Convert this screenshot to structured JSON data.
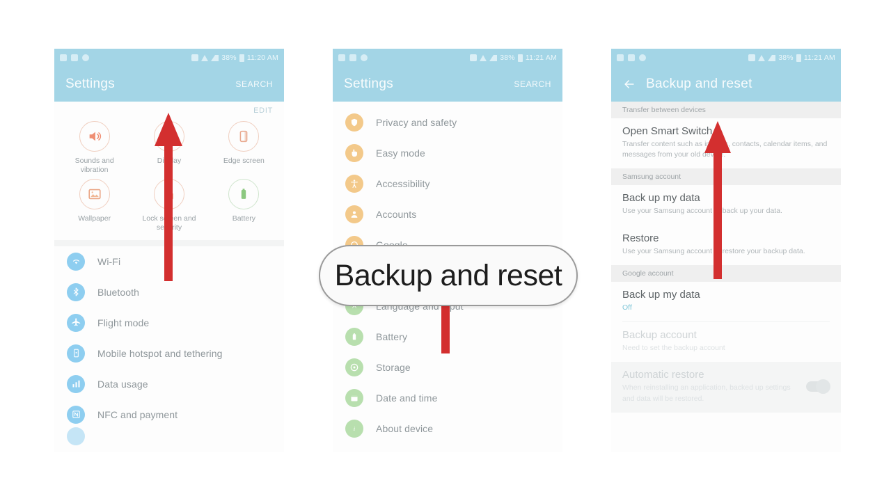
{
  "callout": {
    "text": "Backup and reset"
  },
  "colors": {
    "header_blue": "#a3d5e6",
    "arrow_red": "#d32f2f",
    "icon_blue": "#8ecef0",
    "icon_amber": "#f3c98a",
    "icon_green": "#b8dfae",
    "accent_teal": "#7fc6d8"
  },
  "panel1": {
    "status": {
      "battery": "38%",
      "time": "11:20 AM"
    },
    "appbar": {
      "title": "Settings",
      "action": "SEARCH"
    },
    "edit_label": "EDIT",
    "grid": [
      {
        "label": "Sounds and vibration",
        "icon": "speaker-icon",
        "tone": "amber"
      },
      {
        "label": "Display",
        "icon": "brightness-icon",
        "tone": "amber"
      },
      {
        "label": "Edge screen",
        "icon": "edge-screen-icon",
        "tone": "amber"
      },
      {
        "label": "Wallpaper",
        "icon": "picture-icon",
        "tone": "amber"
      },
      {
        "label": "Lock screen and security",
        "icon": "lock-icon",
        "tone": "amber"
      },
      {
        "label": "Battery",
        "icon": "battery-icon",
        "tone": "green"
      }
    ],
    "list": [
      {
        "label": "Wi-Fi",
        "icon": "wifi-icon",
        "tone": "blue"
      },
      {
        "label": "Bluetooth",
        "icon": "bluetooth-icon",
        "tone": "blue"
      },
      {
        "label": "Flight mode",
        "icon": "airplane-icon",
        "tone": "blue"
      },
      {
        "label": "Mobile hotspot and tethering",
        "icon": "hotspot-icon",
        "tone": "blue"
      },
      {
        "label": "Data usage",
        "icon": "data-usage-icon",
        "tone": "blue"
      },
      {
        "label": "NFC and payment",
        "icon": "nfc-icon",
        "tone": "blue"
      }
    ]
  },
  "panel2": {
    "status": {
      "battery": "38%",
      "time": "11:21 AM"
    },
    "appbar": {
      "title": "Settings",
      "action": "SEARCH"
    },
    "list": [
      {
        "label": "Privacy and safety",
        "icon": "privacy-icon",
        "tone": "amber"
      },
      {
        "label": "Easy mode",
        "icon": "easy-mode-icon",
        "tone": "amber"
      },
      {
        "label": "Accessibility",
        "icon": "accessibility-icon",
        "tone": "amber"
      },
      {
        "label": "Accounts",
        "icon": "accounts-icon",
        "tone": "amber"
      },
      {
        "label": "Google",
        "icon": "google-icon",
        "tone": "amber"
      },
      {
        "label": "Backup and reset",
        "icon": "backup-reset-icon",
        "tone": "green"
      },
      {
        "label": "Language and input",
        "icon": "language-icon",
        "tone": "green"
      },
      {
        "label": "Battery",
        "icon": "battery-icon",
        "tone": "green"
      },
      {
        "label": "Storage",
        "icon": "storage-icon",
        "tone": "green"
      },
      {
        "label": "Date and time",
        "icon": "calendar-icon",
        "tone": "green"
      },
      {
        "label": "About device",
        "icon": "info-icon",
        "tone": "green"
      }
    ]
  },
  "panel3": {
    "status": {
      "battery": "38%",
      "time": "11:21 AM"
    },
    "appbar": {
      "title": "Backup and reset"
    },
    "sections": [
      {
        "header": "Transfer between devices",
        "items": [
          {
            "title": "Open Smart Switch",
            "sub": "Transfer content such as images, contacts, calendar items, and messages from your old device.",
            "state": "normal"
          }
        ]
      },
      {
        "header": "Samsung account",
        "items": [
          {
            "title": "Back up my data",
            "sub": "Use your Samsung account to back up your data.",
            "state": "normal"
          },
          {
            "title": "Restore",
            "sub": "Use your Samsung account to restore your backup data.",
            "state": "normal"
          }
        ]
      },
      {
        "header": "Google account",
        "items": [
          {
            "title": "Back up my data",
            "sub": "Off",
            "state": "accent"
          },
          {
            "title": "Backup account",
            "sub": "Need to set the backup account",
            "state": "dim"
          },
          {
            "title": "Automatic restore",
            "sub": "When reinstalling an application, backed up settings and data will be restored.",
            "state": "dim-toggle"
          }
        ]
      }
    ]
  }
}
